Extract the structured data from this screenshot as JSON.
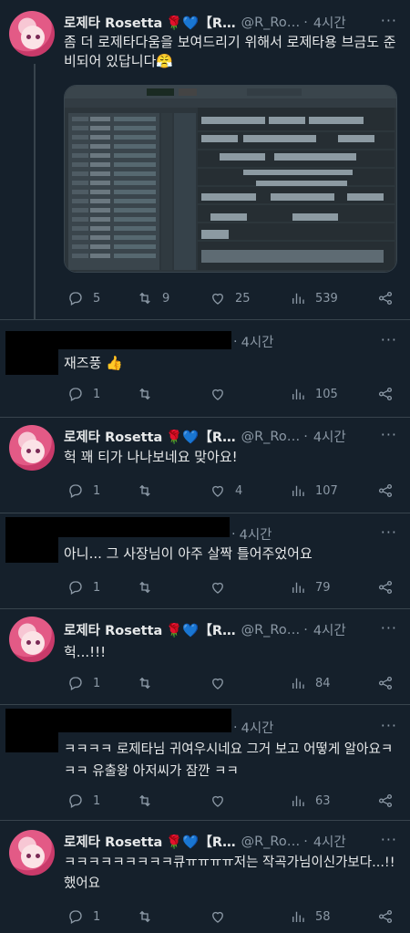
{
  "icons": {
    "reply": "reply-icon",
    "retweet": "retweet-icon",
    "like": "like-icon",
    "views": "views-icon",
    "share": "share-icon",
    "more": "more-icon"
  },
  "colors": {
    "bg": "#15202b",
    "muted": "#8b98a5",
    "text": "#e7e9ea",
    "divider": "#38444d"
  },
  "tweets": [
    {
      "name": "로제타 Rosetta",
      "badges": "🌹💙【R…",
      "handle": "@R_Ro…",
      "dot": "·",
      "time": "4시간",
      "text": "좀 더 로제타다움을 보여드리기 위해서 로제타용 브금도 준비되어 있답니다😤",
      "replies": "5",
      "retweets": "9",
      "likes": "25",
      "views": "539"
    },
    {
      "time": "4시간",
      "dot": "·",
      "text": "재즈풍 👍",
      "replies": "1",
      "retweets": "",
      "likes": "",
      "views": "105"
    },
    {
      "name": "로제타 Rosetta",
      "badges": "🌹💙【R…",
      "handle": "@R_Ro…",
      "dot": "·",
      "time": "4시간",
      "text": "헉 꽤 티가 나나보네요 맞아요!",
      "replies": "1",
      "retweets": "",
      "likes": "4",
      "views": "107"
    },
    {
      "time": "4시간",
      "dot": "·",
      "text": "아니... 그 사장님이 아주 살짝 틀어주었어요",
      "replies": "1",
      "retweets": "",
      "likes": "",
      "views": "79"
    },
    {
      "name": "로제타 Rosetta",
      "badges": "🌹💙【R…",
      "handle": "@R_Ro…",
      "dot": "·",
      "time": "4시간",
      "text": "헉...!!!",
      "replies": "1",
      "retweets": "",
      "likes": "",
      "views": "84"
    },
    {
      "time": "4시간",
      "dot": "·",
      "text": "ㅋㅋㅋㅋ 로제타님 귀여우시네요 그거 보고 어떻게 알아요ㅋㅋㅋ 유출왕 아저씨가 잠깐 ㅋㅋ",
      "replies": "1",
      "retweets": "",
      "likes": "",
      "views": "63"
    },
    {
      "name": "로제타 Rosetta",
      "badges": "🌹💙【R…",
      "handle": "@R_Ro…",
      "dot": "·",
      "time": "4시간",
      "text": "ㅋㅋㅋㅋㅋㅋㅋㅋㅋ큐ㅠㅠㅠㅠ저는 작곡가님이신가보다...!! 했어요",
      "replies": "1",
      "retweets": "",
      "likes": "",
      "views": "58"
    }
  ]
}
